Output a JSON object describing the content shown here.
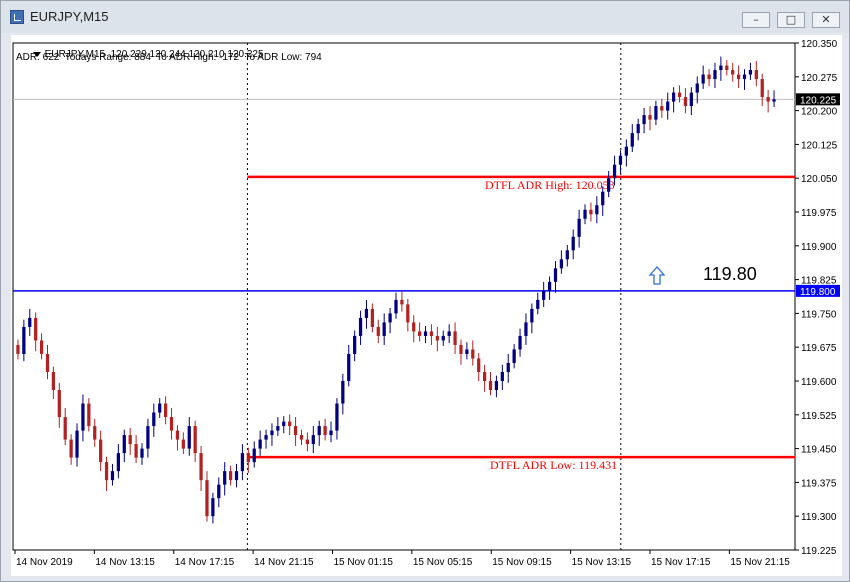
{
  "window": {
    "title": "EURJPY,M15",
    "icon": "chart-app-icon",
    "buttons": {
      "minimize": "–",
      "maximize": "□",
      "close": "✕"
    }
  },
  "header": {
    "line1": "EURJPY,M15  120.229 120.244 120.210 120.225",
    "line2": "ADR: 622  Todays Range: 884  To ADR High: -172  To ADR Low: 794"
  },
  "colors": {
    "bull": "#000080",
    "bear": "#b22222",
    "adr_line": "#ff0000",
    "level_line": "#0000ff",
    "arrow": "#2f6fd6",
    "grid_dotted": "#000000",
    "current_price_line": "#c0c0c0"
  },
  "annotations": {
    "level_text": "119.80",
    "adr_high_label": "DTFL ADR High: 120.053",
    "adr_low_label": "DTFL ADR Low: 119.431",
    "arrow_icon": "up-arrow-icon"
  },
  "chart_data": {
    "type": "candlestick",
    "symbol": "EURJPY",
    "timeframe": "M15",
    "ylim": [
      119.225,
      120.35
    ],
    "yticks": [
      "120.350",
      "120.275",
      "120.200",
      "120.125",
      "120.050",
      "119.975",
      "119.900",
      "119.825",
      "119.750",
      "119.675",
      "119.600",
      "119.525",
      "119.450",
      "119.375",
      "119.300",
      "119.225"
    ],
    "xticks": [
      "14 Nov 2019",
      "14 Nov 13:15",
      "14 Nov 17:15",
      "14 Nov 21:15",
      "15 Nov 01:15",
      "15 Nov 05:15",
      "15 Nov 09:15",
      "15 Nov 13:15",
      "15 Nov 17:15",
      "15 Nov 21:15"
    ],
    "current_price": {
      "label": "120.225",
      "value": 120.225
    },
    "level_line": {
      "label": "119.800",
      "value": 119.8
    },
    "adr_high": {
      "value": 120.053,
      "label": "DTFL ADR High: 120.053"
    },
    "adr_low": {
      "value": 119.431,
      "label": "DTFL ADR Low: 119.431"
    },
    "closes": [
      119.66,
      119.72,
      119.74,
      119.69,
      119.66,
      119.62,
      119.58,
      119.52,
      119.47,
      119.43,
      119.49,
      119.55,
      119.5,
      119.47,
      119.42,
      119.38,
      119.4,
      119.44,
      119.48,
      119.46,
      119.43,
      119.45,
      119.5,
      119.53,
      119.55,
      119.52,
      119.49,
      119.47,
      119.45,
      119.5,
      119.44,
      119.38,
      119.3,
      119.34,
      119.37,
      119.4,
      119.38,
      119.4,
      119.44,
      119.42,
      119.45,
      119.47,
      119.48,
      119.49,
      119.5,
      119.51,
      119.5,
      119.48,
      119.47,
      119.46,
      119.48,
      119.5,
      119.48,
      119.49,
      119.55,
      119.6,
      119.66,
      119.7,
      119.74,
      119.76,
      119.72,
      119.7,
      119.73,
      119.75,
      119.78,
      119.77,
      119.73,
      119.71,
      119.7,
      119.71,
      119.7,
      119.69,
      119.7,
      119.71,
      119.68,
      119.66,
      119.67,
      119.65,
      119.62,
      119.6,
      119.58,
      119.6,
      119.62,
      119.64,
      119.67,
      119.7,
      119.73,
      119.76,
      119.78,
      119.8,
      119.82,
      119.85,
      119.87,
      119.89,
      119.92,
      119.96,
      119.98,
      119.97,
      119.99,
      120.02,
      120.05,
      120.08,
      120.1,
      120.12,
      120.15,
      120.17,
      120.19,
      120.18,
      120.21,
      120.2,
      120.22,
      120.24,
      120.23,
      120.21,
      120.24,
      120.26,
      120.28,
      120.27,
      120.29,
      120.3,
      120.29,
      120.28,
      120.27,
      120.28,
      120.29,
      120.27,
      120.23,
      120.22,
      120.225
    ]
  }
}
